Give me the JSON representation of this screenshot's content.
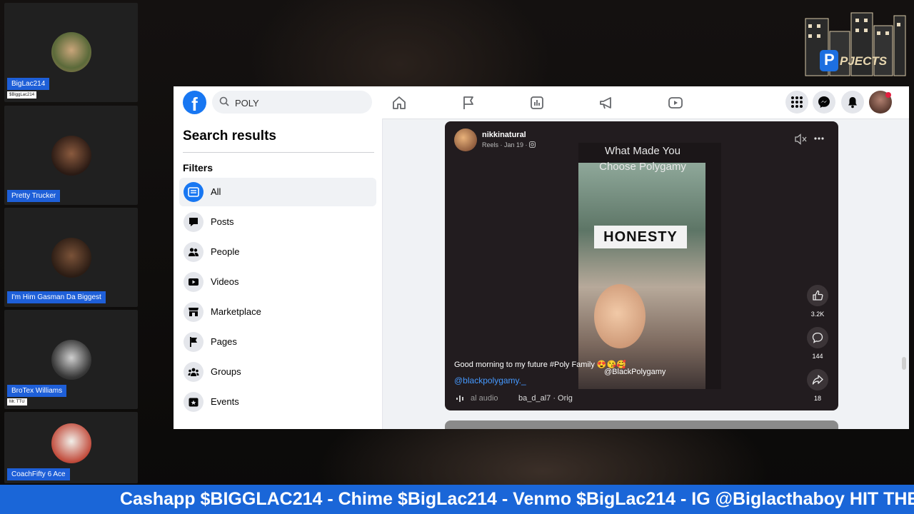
{
  "participants": [
    {
      "name": "BigLac214",
      "sub": "$BiggLac214"
    },
    {
      "name": "Pretty Trucker",
      "sub": ""
    },
    {
      "name": "I'm Him Gasman Da Biggest",
      "sub": ""
    },
    {
      "name": "BroTex Williams",
      "sub": "Mr. TTU"
    },
    {
      "name": "CoachFifty 6 Ace",
      "sub": ""
    }
  ],
  "logo": {
    "text": "PJECTS",
    "letter": "P"
  },
  "facebook": {
    "search_value": "POLY",
    "search_results_title": "Search results",
    "filters_label": "Filters",
    "filters": [
      "All",
      "Posts",
      "People",
      "Videos",
      "Marketplace",
      "Pages",
      "Groups",
      "Events"
    ],
    "accent": "#1877f2"
  },
  "reel": {
    "username": "nikkinatural",
    "meta": "Reels · Jan 19 ·",
    "video_title_1": "What Made You",
    "video_title_2": "Choose Polygamy",
    "video_overlay": "HONESTY",
    "video_handle": "@BlackPolygamy",
    "caption": "Good morning to my future #Poly Family 😍😘🥰",
    "link": "@blackpolygamy._",
    "audio_prefix": "al audio",
    "audio_track": "ba_d_al7 · Orig",
    "likes": "3.2K",
    "comments": "144",
    "shares": "18"
  },
  "ticker": "Cashapp $BIGGLAC214 - Chime $BigLac214 - Venmo $BigLac214 - IG @Biglacthaboy HIT THE"
}
